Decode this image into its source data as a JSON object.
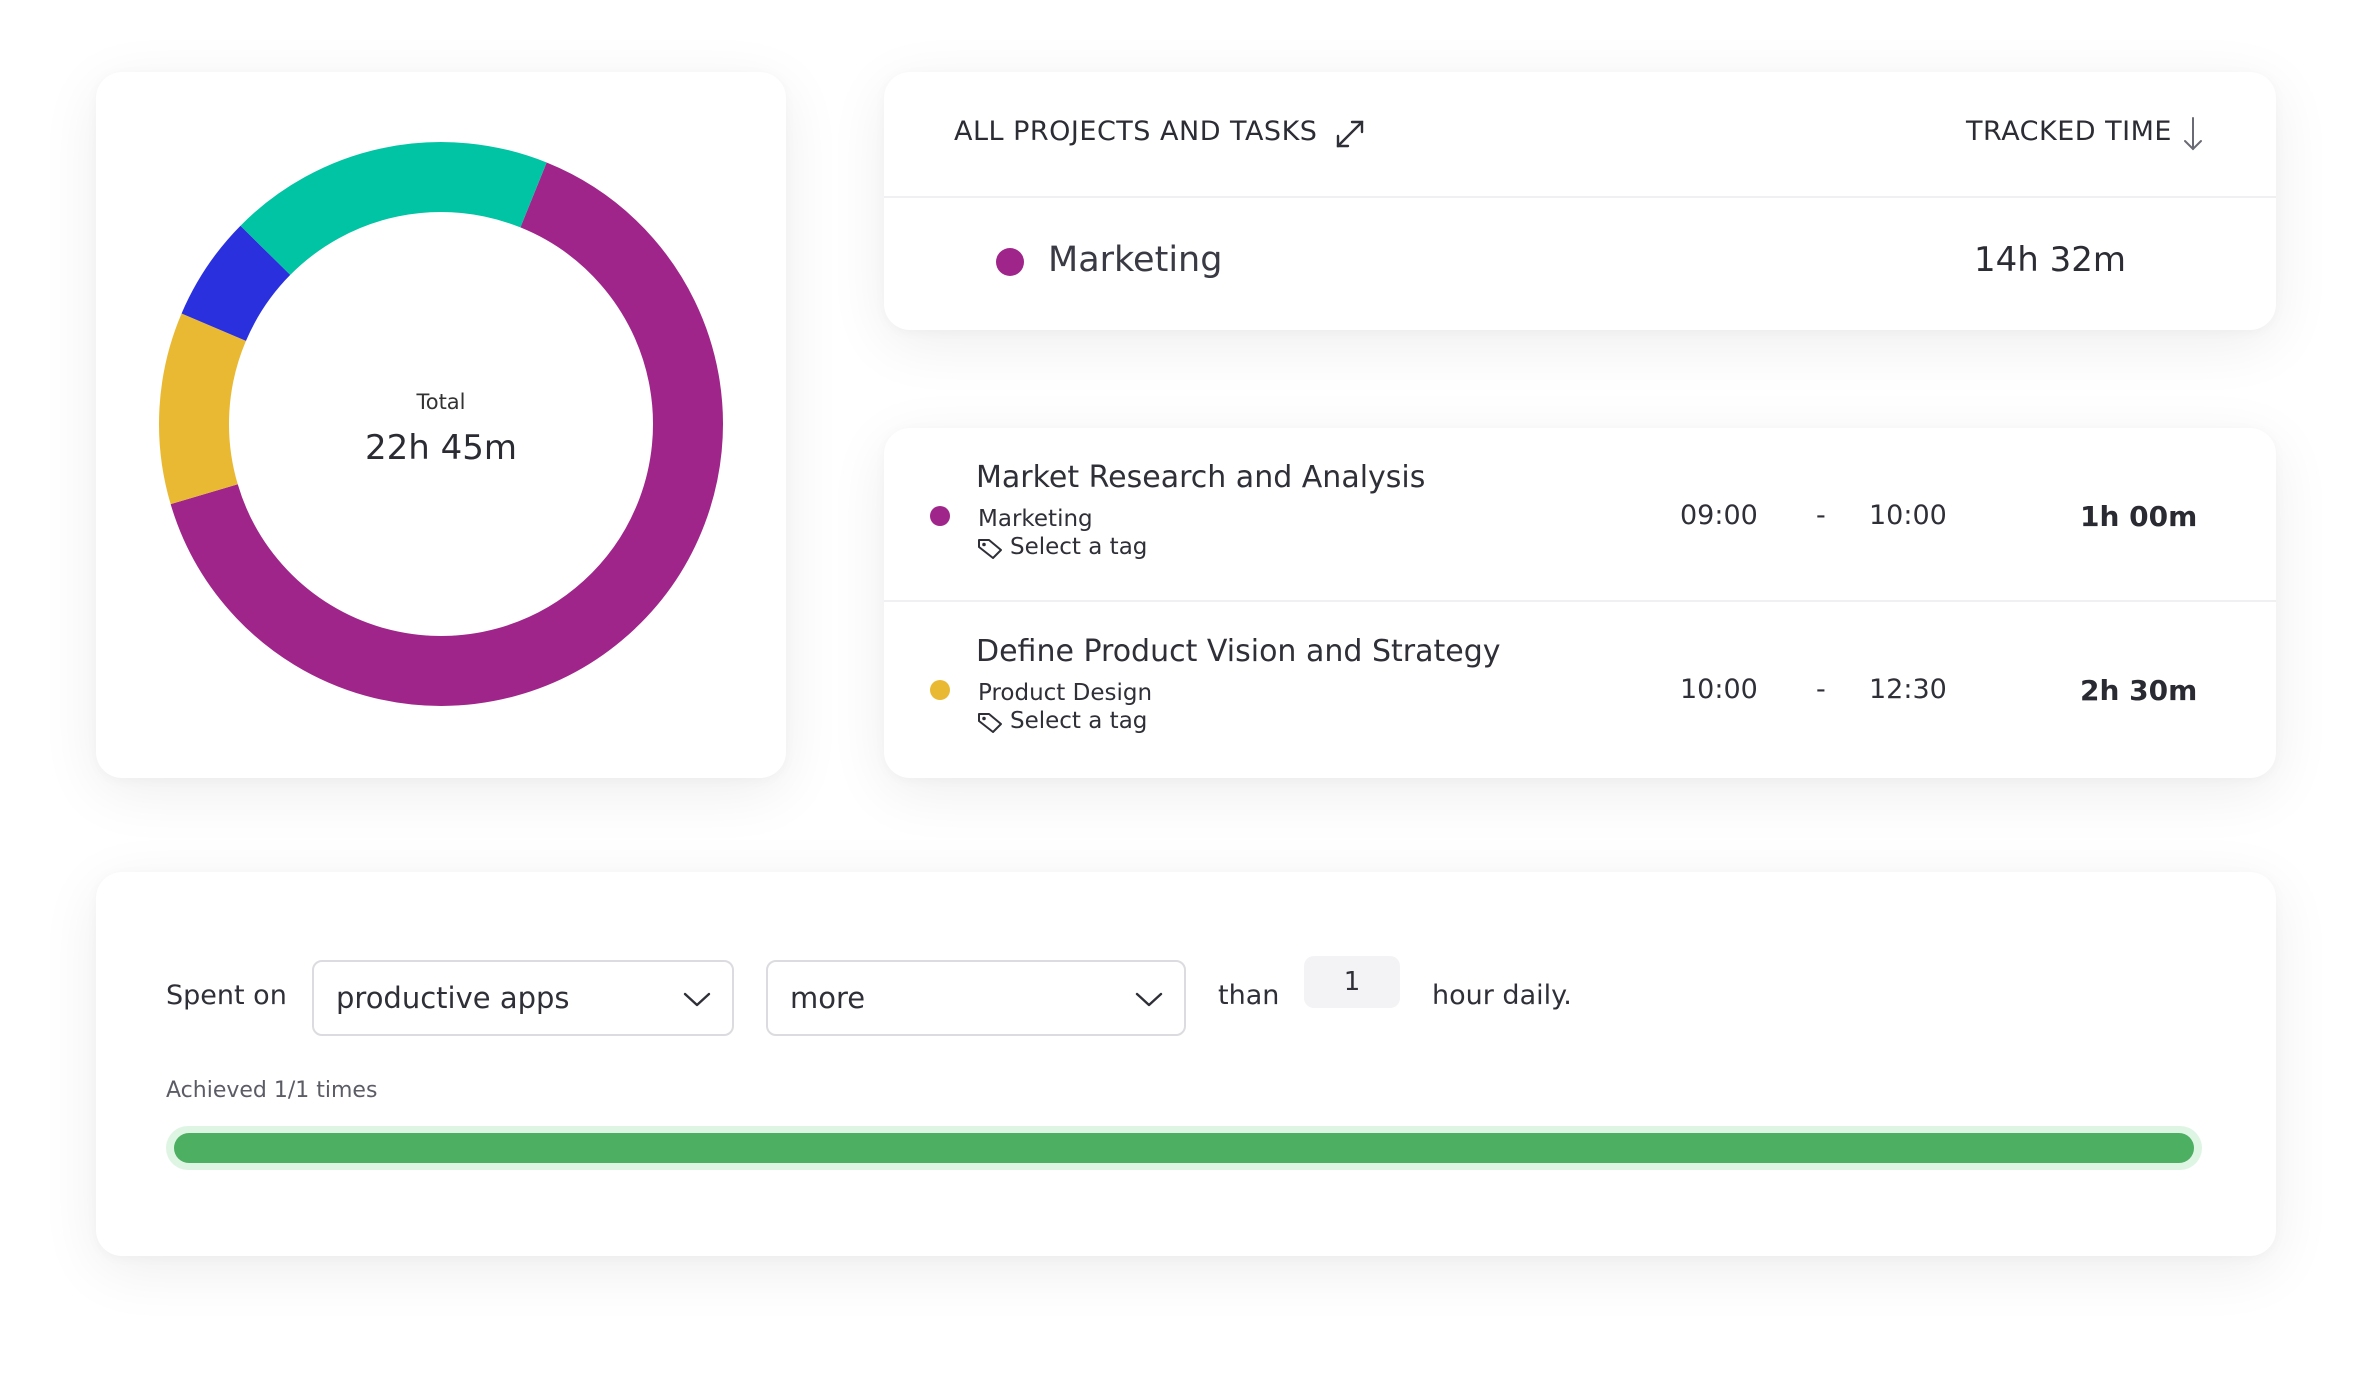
{
  "colors": {
    "marketing": "#a0258a",
    "product_design": "#eab934",
    "teal": "#00c4a4",
    "blue": "#2a30dd",
    "progress": "#4caf62"
  },
  "donut": {
    "total_label": "Total",
    "total_value": "22h 45m",
    "segments": [
      {
        "color": "#a0258a",
        "fraction": 0.643
      },
      {
        "color": "#eab934",
        "fraction": 0.11
      },
      {
        "color": "#2a30dd",
        "fraction": 0.06
      },
      {
        "color": "#00c4a4",
        "fraction": 0.187
      }
    ]
  },
  "summary": {
    "header_title": "ALL PROJECTS AND TASKS",
    "expand_icon": "expand-icon",
    "tracked_header": "TRACKED TIME",
    "sort_icon": "arrow-down-icon",
    "project": {
      "name": "Marketing",
      "time": "14h 32m",
      "color": "#a0258a"
    }
  },
  "entries": [
    {
      "title": "Market Research and Analysis",
      "project": "Marketing",
      "tag": "Select a tag",
      "start": "09:00",
      "separator": "-",
      "end": "10:00",
      "duration": "1h 00m",
      "color": "#a0258a"
    },
    {
      "title": "Define Product Vision and Strategy",
      "project": "Product Design",
      "tag": "Select a tag",
      "start": "10:00",
      "separator": "-",
      "end": "12:30",
      "duration": "2h 30m",
      "color": "#eab934"
    }
  ],
  "goal": {
    "spent_on_label": "Spent on",
    "category_select": "productive apps",
    "comparison_select": "more",
    "than_label": "than",
    "amount": "1",
    "unit_label": "hour daily.",
    "achieved_text": "Achieved 1/1 times",
    "progress_fraction": 1.0
  }
}
